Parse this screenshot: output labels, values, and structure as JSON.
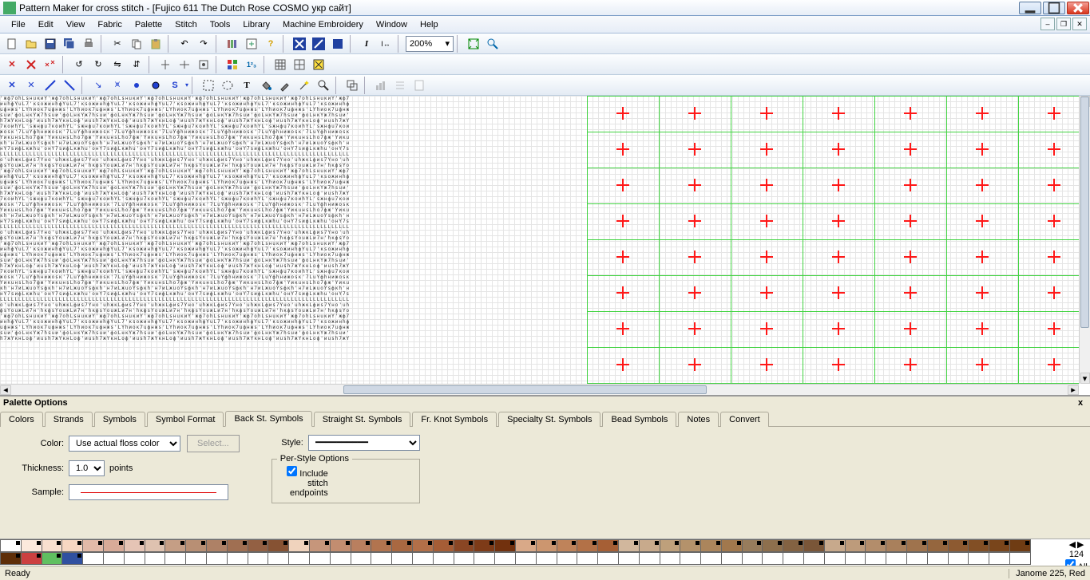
{
  "app": {
    "title": "Pattern Maker for cross stitch - [Fujico 611 The Dutch Rose COSMO укр сайт]"
  },
  "menu": [
    "File",
    "Edit",
    "View",
    "Fabric",
    "Palette",
    "Stitch",
    "Tools",
    "Library",
    "Machine Embroidery",
    "Window",
    "Help"
  ],
  "zoom": "200%",
  "panel": {
    "title": "Palette Options",
    "tabs": [
      "Colors",
      "Strands",
      "Symbols",
      "Symbol Format",
      "Back St. Symbols",
      "Straight St. Symbols",
      "Fr. Knot Symbols",
      "Specialty St. Symbols",
      "Bead Symbols",
      "Notes",
      "Convert"
    ],
    "active_tab": 4,
    "color_label": "Color:",
    "color_value": "Use actual floss color",
    "select_btn": "Select...",
    "thickness_label": "Thickness:",
    "thickness_value": "1.0",
    "thickness_unit": "points",
    "sample_label": "Sample:",
    "style_label": "Style:",
    "perstyle_legend": "Per-Style Options",
    "include_cb": "Include stitch endpoints",
    "include_checked": true
  },
  "palette_colors_row1": [
    "#ffffff",
    "#fce9dc",
    "#f9e0cf",
    "#f7d7c2",
    "#e2baa8",
    "#d8ab98",
    "#e5c4b5",
    "#dec2b0",
    "#c59e85",
    "#b88f74",
    "#ae8166",
    "#a06f52",
    "#936043",
    "#865233",
    "#f0d3bd",
    "#c6967b",
    "#c28d70",
    "#b97f5f",
    "#b2744f",
    "#a96841",
    "#b36f48",
    "#a65d36",
    "#8a4624",
    "#7e3b18",
    "#72310e",
    "#d9a988",
    "#cc966f",
    "#bf835a",
    "#b37147",
    "#a65f35",
    "#d1b79d",
    "#c8aa8c",
    "#bea07b",
    "#b4926b",
    "#ab855c",
    "#a1784d",
    "#977c5c",
    "#8d6f4d",
    "#836242",
    "#7a5638",
    "#c7a98c",
    "#bd9b7b",
    "#b38d6b",
    "#a9805c",
    "#9f734d",
    "#95663e",
    "#8d5a31",
    "#824f25",
    "#79451b",
    "#6f3c13"
  ],
  "palette_colors_row2": [
    "#5e2e08",
    "#cc4040",
    "#60c060",
    "#3050a0"
  ],
  "strip_right": {
    "count": "124",
    "all_label": "All"
  },
  "status": {
    "left": "Ready",
    "right": "Janome  225, Red"
  }
}
